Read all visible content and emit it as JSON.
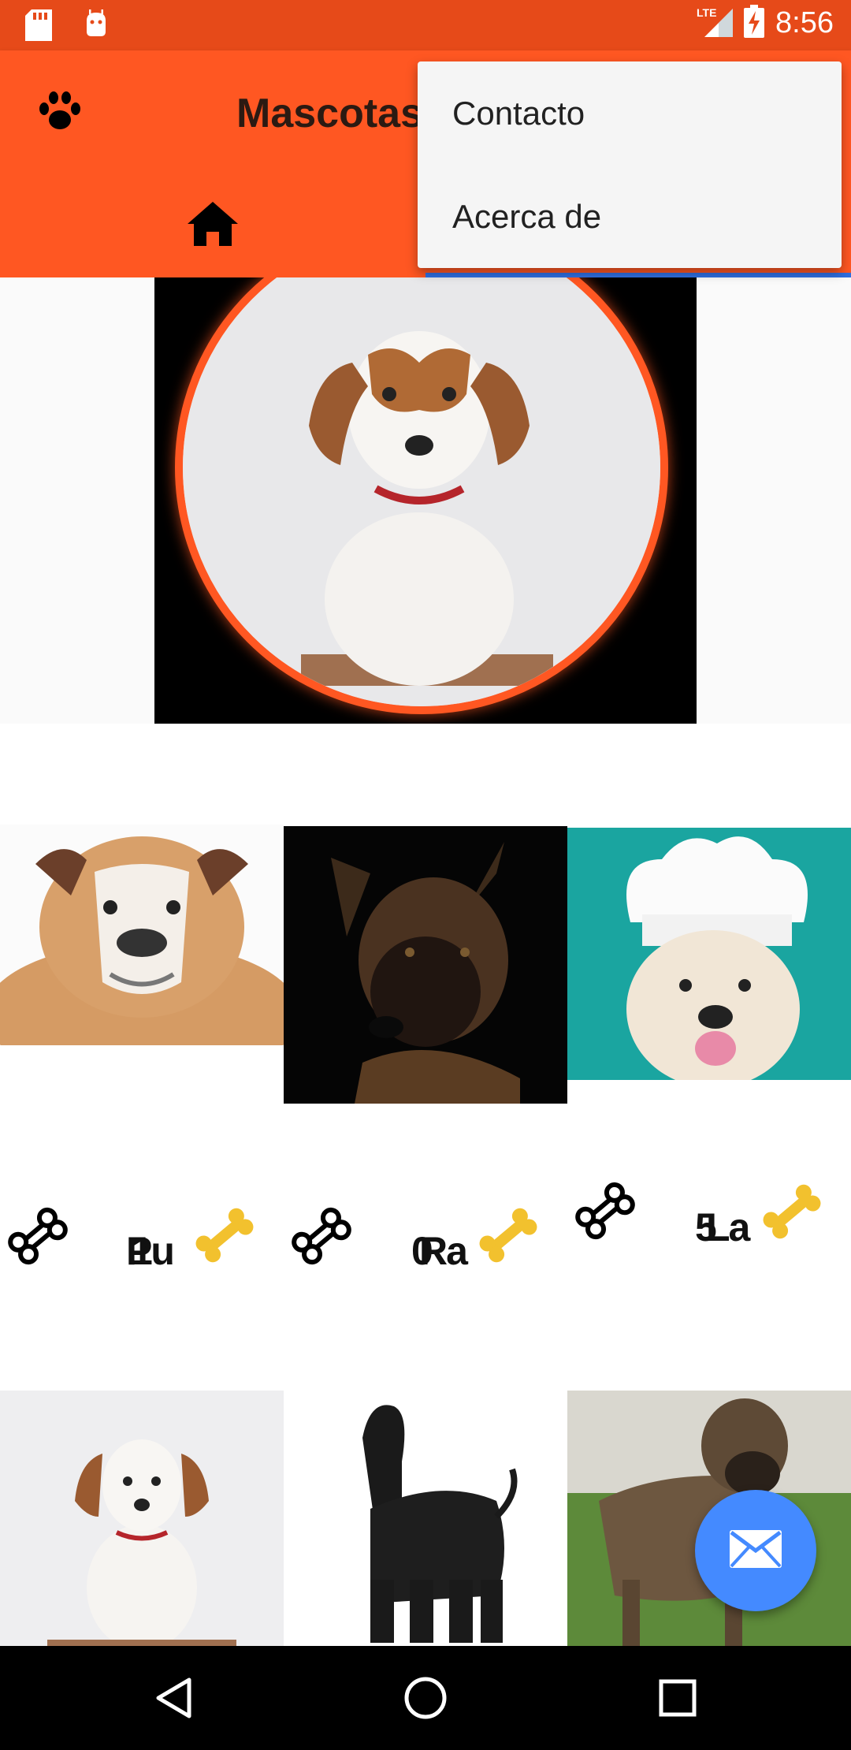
{
  "status_bar": {
    "time": "8:56",
    "network": "LTE",
    "left_icons": [
      "sd-card-icon",
      "android-debug-icon"
    ],
    "right_icons": [
      "signal-icon",
      "battery-charging-icon"
    ]
  },
  "app_bar": {
    "title": "Mascotas",
    "logo_icon": "paw-icon"
  },
  "tabs": [
    {
      "icon": "home-icon",
      "label": ""
    },
    {
      "icon": "pet-icon",
      "label": "",
      "selected": true
    }
  ],
  "overflow_menu": {
    "items": [
      "Contacto",
      "Acerca de"
    ]
  },
  "profile": {
    "photo": "jack-russell-puppy"
  },
  "pets": [
    {
      "name": "Pu",
      "likes": "1",
      "photo": "bulldog"
    },
    {
      "name": "Ra",
      "likes": "0",
      "photo": "german-shepherd"
    },
    {
      "name": "La",
      "likes": "5",
      "photo": "golden-chef"
    },
    {
      "name": "",
      "likes": "",
      "photo": "jack-russell"
    },
    {
      "name": "",
      "likes": "",
      "photo": "afghan-hound"
    },
    {
      "name": "",
      "likes": "",
      "photo": "mastiff"
    }
  ],
  "fab": {
    "icon": "email-icon"
  },
  "nav_bar": [
    "back-icon",
    "home-circle-icon",
    "recents-icon"
  ],
  "colors": {
    "primary": "#ff5722",
    "primary_dark": "#e64a19",
    "accent": "#448aff",
    "tab_indicator": "#2f6fe0"
  }
}
